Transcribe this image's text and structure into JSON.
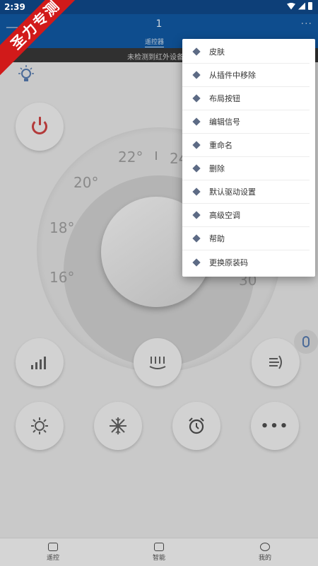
{
  "status_bar": {
    "time": "2:39"
  },
  "header": {
    "title": "1",
    "tab_label": "遥控器",
    "more_label": "···"
  },
  "subheader": {
    "notice": "未检测到红外设备"
  },
  "watermark": "圣力专测",
  "dial": {
    "temps": [
      "22°",
      "24",
      "20°",
      "18°",
      "16°",
      "30"
    ]
  },
  "menu": {
    "items": [
      {
        "label": "皮肤"
      },
      {
        "label": "从插件中移除"
      },
      {
        "label": "布局按钮"
      },
      {
        "label": "编辑信号"
      },
      {
        "label": "重命名"
      },
      {
        "label": "删除"
      },
      {
        "label": "默认驱动设置"
      },
      {
        "label": "高级空调"
      },
      {
        "label": "帮助"
      },
      {
        "label": "更换原装码"
      }
    ]
  },
  "buttons": {
    "row1": [
      {
        "icon": "signal-bars-icon"
      },
      {
        "icon": "airflow-icon"
      },
      {
        "icon": "swing-icon"
      }
    ],
    "row2": [
      {
        "icon": "sun-icon"
      },
      {
        "icon": "snowflake-icon"
      },
      {
        "icon": "alarm-clock-icon"
      },
      {
        "icon": "more-dots-icon",
        "label": "•••"
      }
    ]
  },
  "bottom_nav": {
    "items": [
      {
        "label": "遥控"
      },
      {
        "label": "智能"
      },
      {
        "label": "我的"
      }
    ]
  },
  "colors": {
    "header_bg": "#0e4d8e",
    "status_bg": "#0d3f78",
    "watermark_bg": "#d11a1a",
    "power_red": "#b33a3a",
    "menu_bullet": "#5d6b85"
  }
}
